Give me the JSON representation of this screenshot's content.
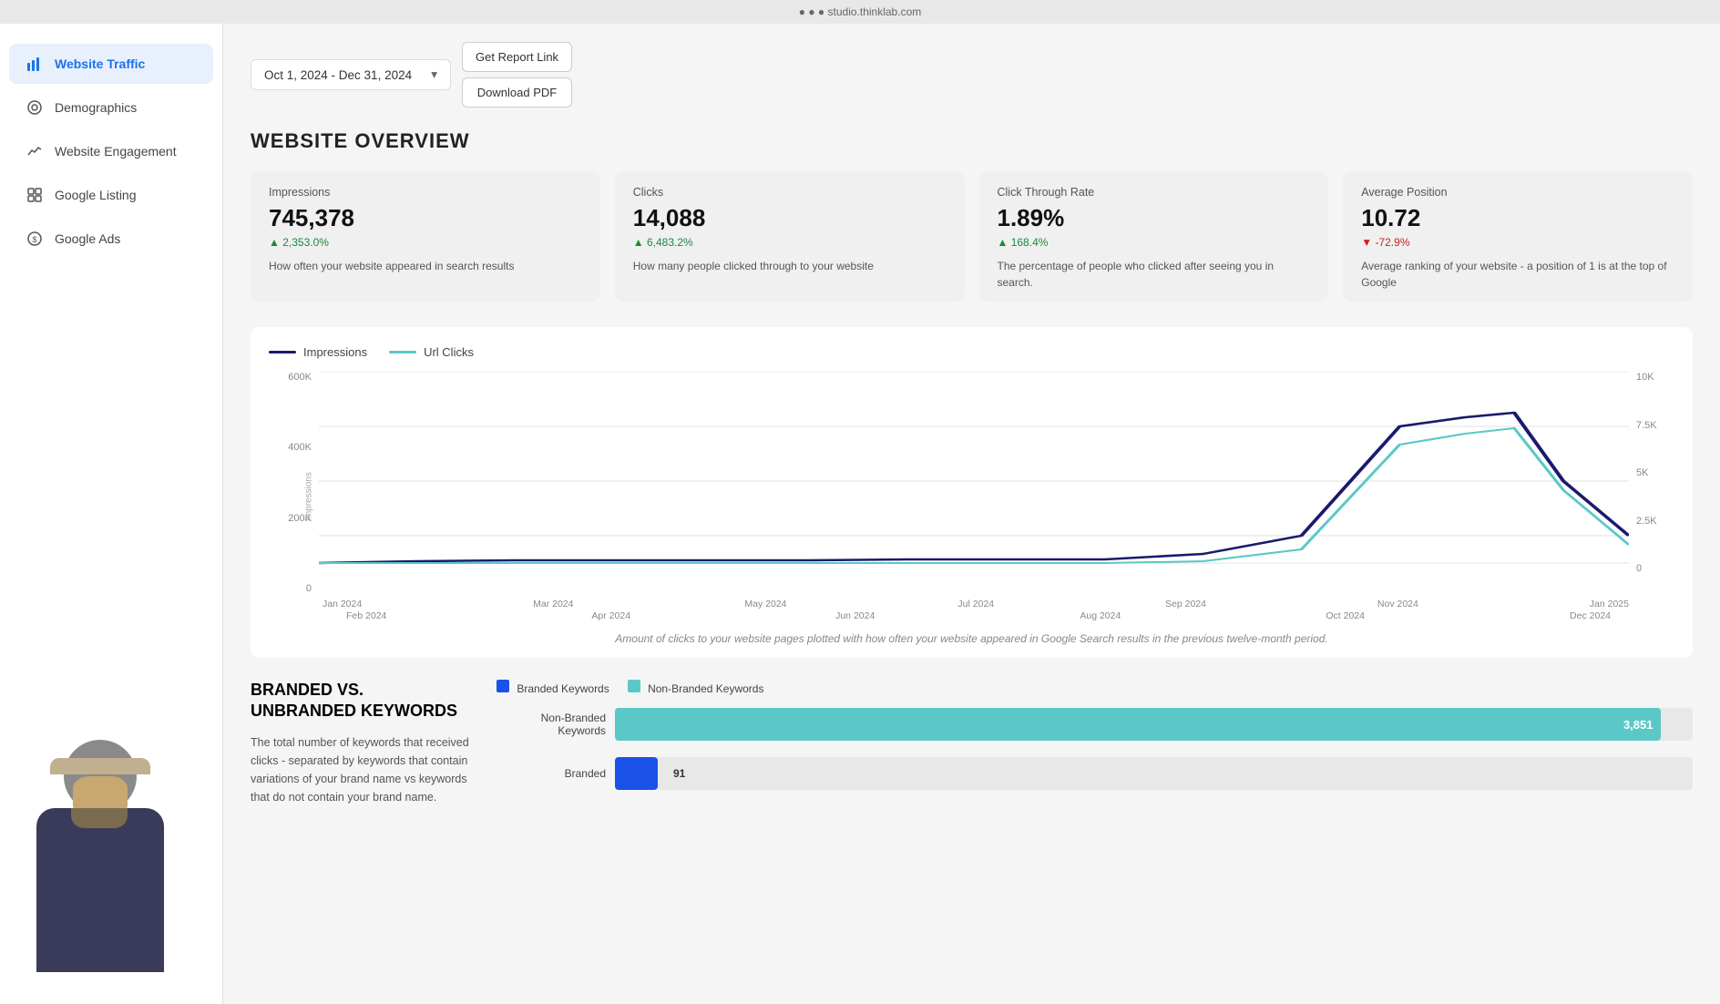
{
  "sidebar": {
    "items": [
      {
        "id": "website-traffic",
        "label": "Website Traffic",
        "icon": "chart-icon",
        "active": true
      },
      {
        "id": "demographics",
        "label": "Demographics",
        "icon": "search-icon",
        "active": false
      },
      {
        "id": "website-engagement",
        "label": "Website Engagement",
        "icon": "trending-icon",
        "active": false
      },
      {
        "id": "google-listing",
        "label": "Google Listing",
        "icon": "grid-icon",
        "active": false
      },
      {
        "id": "google-ads",
        "label": "Google Ads",
        "icon": "circle-icon",
        "active": false
      }
    ]
  },
  "header": {
    "date_range": "Oct 1, 2024 - Dec 31, 2024",
    "get_report_btn": "Get Report Link",
    "download_pdf_btn": "Download PDF"
  },
  "overview": {
    "title": "WEBSITE OVERVIEW",
    "stats": [
      {
        "label": "Impressions",
        "value": "745,378",
        "change": "▲ 2,353.0%",
        "change_type": "up",
        "description": "How often your website appeared in search results"
      },
      {
        "label": "Clicks",
        "value": "14,088",
        "change": "▲ 6,483.2%",
        "change_type": "up",
        "description": "How many people clicked through to your website"
      },
      {
        "label": "Click Through Rate",
        "value": "1.89%",
        "change": "▲ 168.4%",
        "change_type": "up",
        "description": "The percentage of people who clicked after seeing you in search."
      },
      {
        "label": "Average Position",
        "value": "10.72",
        "change": "▼ -72.9%",
        "change_type": "down",
        "description": "Average ranking of your website - a position of 1 is at the top of Google"
      }
    ]
  },
  "chart": {
    "legend": {
      "impressions_label": "Impressions",
      "url_clicks_label": "Url Clicks"
    },
    "y_axis_label": "Impressions",
    "y_axis_ticks": [
      "600K",
      "400K",
      "200K",
      "0"
    ],
    "y_axis_right_ticks": [
      "10K",
      "7.5K",
      "5K",
      "2.5K",
      "0"
    ],
    "x_axis_top": [
      "Jan 2024",
      "Mar 2024",
      "May 2024",
      "Jul 2024",
      "Sep 2024",
      "Nov 2024",
      "Jan 2025"
    ],
    "x_axis_bottom": [
      "Feb 2024",
      "Apr 2024",
      "Jun 2024",
      "Aug 2024",
      "Oct 2024",
      "Dec 2024"
    ],
    "caption": "Amount of clicks to your website pages plotted with how often your website appeared in Google Search results in the previous twelve-month period."
  },
  "branded": {
    "title": "BRANDED VS. UNBRANDED KEYWORDS",
    "description": "The total number of keywords that received clicks - separated by keywords that contain variations of your brand name vs keywords that do not contain your brand name.",
    "legend": {
      "branded_label": "Branded Keywords",
      "non_branded_label": "Non-Branded Keywords"
    },
    "bars": [
      {
        "label": "Non-Branded\nKeywords",
        "value": "3,851",
        "type": "non-branded",
        "width_pct": 97
      },
      {
        "label": "Branded",
        "value": "91",
        "type": "branded",
        "width_pct": 3
      }
    ]
  }
}
